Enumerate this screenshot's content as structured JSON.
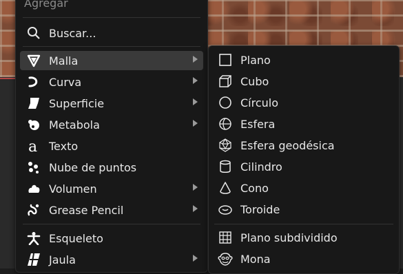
{
  "menu": {
    "title": "Agregar",
    "search_label": "Buscar...",
    "items": [
      {
        "label": "Malla",
        "icon": "mesh-icon",
        "submenu": true,
        "active": true
      },
      {
        "label": "Curva",
        "icon": "curve-icon",
        "submenu": true
      },
      {
        "label": "Superficie",
        "icon": "surface-icon",
        "submenu": true
      },
      {
        "label": "Metabola",
        "icon": "metaball-icon",
        "submenu": true
      },
      {
        "label": "Texto",
        "icon": "text-icon",
        "submenu": false
      },
      {
        "label": "Nube de puntos",
        "icon": "point-cloud-icon",
        "submenu": false
      },
      {
        "label": "Volumen",
        "icon": "volume-icon",
        "submenu": true
      },
      {
        "label": "Grease Pencil",
        "icon": "grease-pencil-icon",
        "submenu": true
      },
      {
        "label": "Esqueleto",
        "icon": "armature-icon",
        "submenu": false
      },
      {
        "label": "Jaula",
        "icon": "lattice-icon",
        "submenu": true
      }
    ]
  },
  "submenu": {
    "items": [
      {
        "label": "Plano",
        "icon": "plane-icon"
      },
      {
        "label": "Cubo",
        "icon": "cube-icon"
      },
      {
        "label": "Círculo",
        "icon": "circle-icon"
      },
      {
        "label": "Esfera",
        "icon": "uv-sphere-icon"
      },
      {
        "label": "Esfera geodésica",
        "icon": "ico-sphere-icon"
      },
      {
        "label": "Cilindro",
        "icon": "cylinder-icon"
      },
      {
        "label": "Cono",
        "icon": "cone-icon"
      },
      {
        "label": "Toroide",
        "icon": "torus-icon"
      },
      {
        "label": "Plano subdividido",
        "icon": "grid-icon"
      },
      {
        "label": "Mona",
        "icon": "monkey-icon"
      }
    ]
  }
}
